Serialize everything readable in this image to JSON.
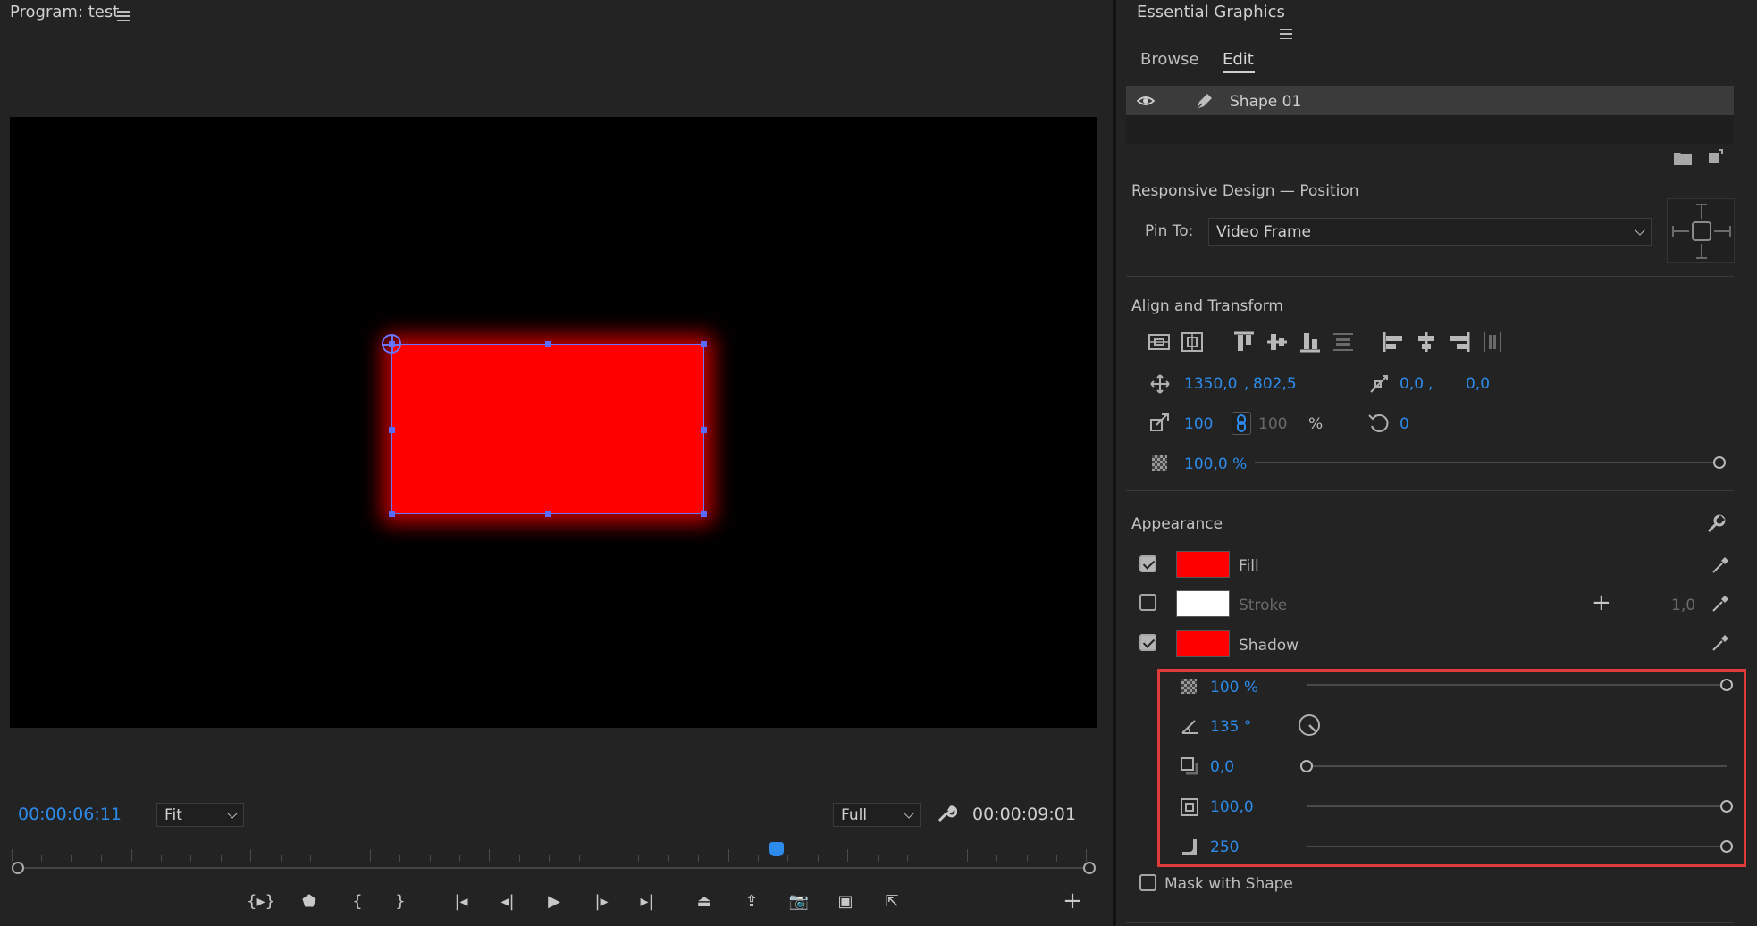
{
  "monitor": {
    "title": "Program: test",
    "timecode_current": "00:00:06:11",
    "zoom": "Fit",
    "quality": "Full",
    "timecode_duration": "00:00:09:01",
    "transport": [
      {
        "name": "mark-in-out-button",
        "glyph": "{▸}"
      },
      {
        "name": "add-marker-button",
        "glyph": "⬟"
      },
      {
        "name": "mark-in-button",
        "glyph": "{"
      },
      {
        "name": "mark-out-button",
        "glyph": "}"
      },
      {
        "name": "go-to-in-button",
        "glyph": "|◂"
      },
      {
        "name": "step-back-button",
        "glyph": "◂|"
      },
      {
        "name": "play-button",
        "glyph": "▶"
      },
      {
        "name": "step-forward-button",
        "glyph": "|▸"
      },
      {
        "name": "go-to-out-button",
        "glyph": "▸|"
      },
      {
        "name": "lift-button",
        "glyph": "⏏"
      },
      {
        "name": "extract-button",
        "glyph": "⇪"
      },
      {
        "name": "export-frame-button",
        "glyph": "📷"
      },
      {
        "name": "comparison-view-button",
        "glyph": "▣"
      },
      {
        "name": "export-button",
        "glyph": "⇱"
      }
    ],
    "add_button": "+"
  },
  "eg": {
    "title": "Essential Graphics",
    "tabs": [
      "Browse",
      "Edit"
    ],
    "active_tab": "Edit",
    "layer_name": "Shape 01",
    "responsive": {
      "heading": "Responsive Design — Position",
      "pin_label": "Pin To:",
      "pin_value": "Video Frame"
    },
    "align": {
      "heading": "Align and Transform",
      "pos_x": "1350,0",
      "pos_sep": ",",
      "pos_y": "802,5",
      "anchor_x": "0,0",
      "anchor_sep": ",",
      "anchor_y": "0,0",
      "scale": "100",
      "scale_h": "100",
      "scale_unit": "%",
      "rotation": "0",
      "opacity": "100,0 %",
      "opacity_level": 1.0
    },
    "appearance": {
      "heading": "Appearance",
      "fill_label": "Fill",
      "fill_color": "#ff0000",
      "fill_on": true,
      "stroke_label": "Stroke",
      "stroke_color": "#ffffff",
      "stroke_on": false,
      "stroke_width": "1,0",
      "shadow_label": "Shadow",
      "shadow_color": "#ff0000",
      "shadow_on": true,
      "shadow": {
        "opacity": "100",
        "opacity_unit": "%",
        "opacity_level": 1.0,
        "angle": "135",
        "angle_unit": "°",
        "distance": "0,0",
        "distance_level": 0.0,
        "size": "100,0",
        "size_level": 1.0,
        "blur": "250",
        "blur_level": 1.0
      },
      "mask_label": "Mask with Shape"
    }
  }
}
